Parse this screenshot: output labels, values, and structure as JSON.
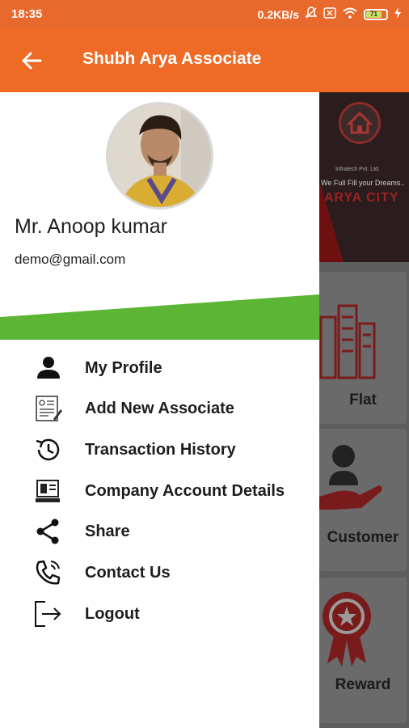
{
  "status_bar": {
    "time": "18:35",
    "speed": "0.2KB/s",
    "battery": "71"
  },
  "app_bar": {
    "title": "Shubh Arya Associate",
    "back_icon": "arrow-left-icon"
  },
  "profile": {
    "name": "Mr. Anoop kumar",
    "email": "demo@gmail.com"
  },
  "menu": {
    "items": [
      {
        "label": "My Profile",
        "icon": "person-icon"
      },
      {
        "label": "Add New Associate",
        "icon": "form-document-icon"
      },
      {
        "label": "Transaction History",
        "icon": "history-clock-icon"
      },
      {
        "label": "Company Account Details",
        "icon": "computer-account-icon"
      },
      {
        "label": "Share",
        "icon": "share-icon"
      },
      {
        "label": "Contact Us",
        "icon": "phone-icon"
      },
      {
        "label": "Logout",
        "icon": "logout-icon"
      }
    ]
  },
  "background": {
    "banner_tagline": "We Full Fill your Dreams..",
    "banner_company": "Infratech Pvt. Ltd.",
    "banner_city": "ARYA CITY",
    "cards": [
      "Flat",
      "Customer",
      "Reward"
    ]
  },
  "colors": {
    "accent": "#ef6a25",
    "green_band": "#5cb534",
    "banner_red": "#9a2222"
  }
}
